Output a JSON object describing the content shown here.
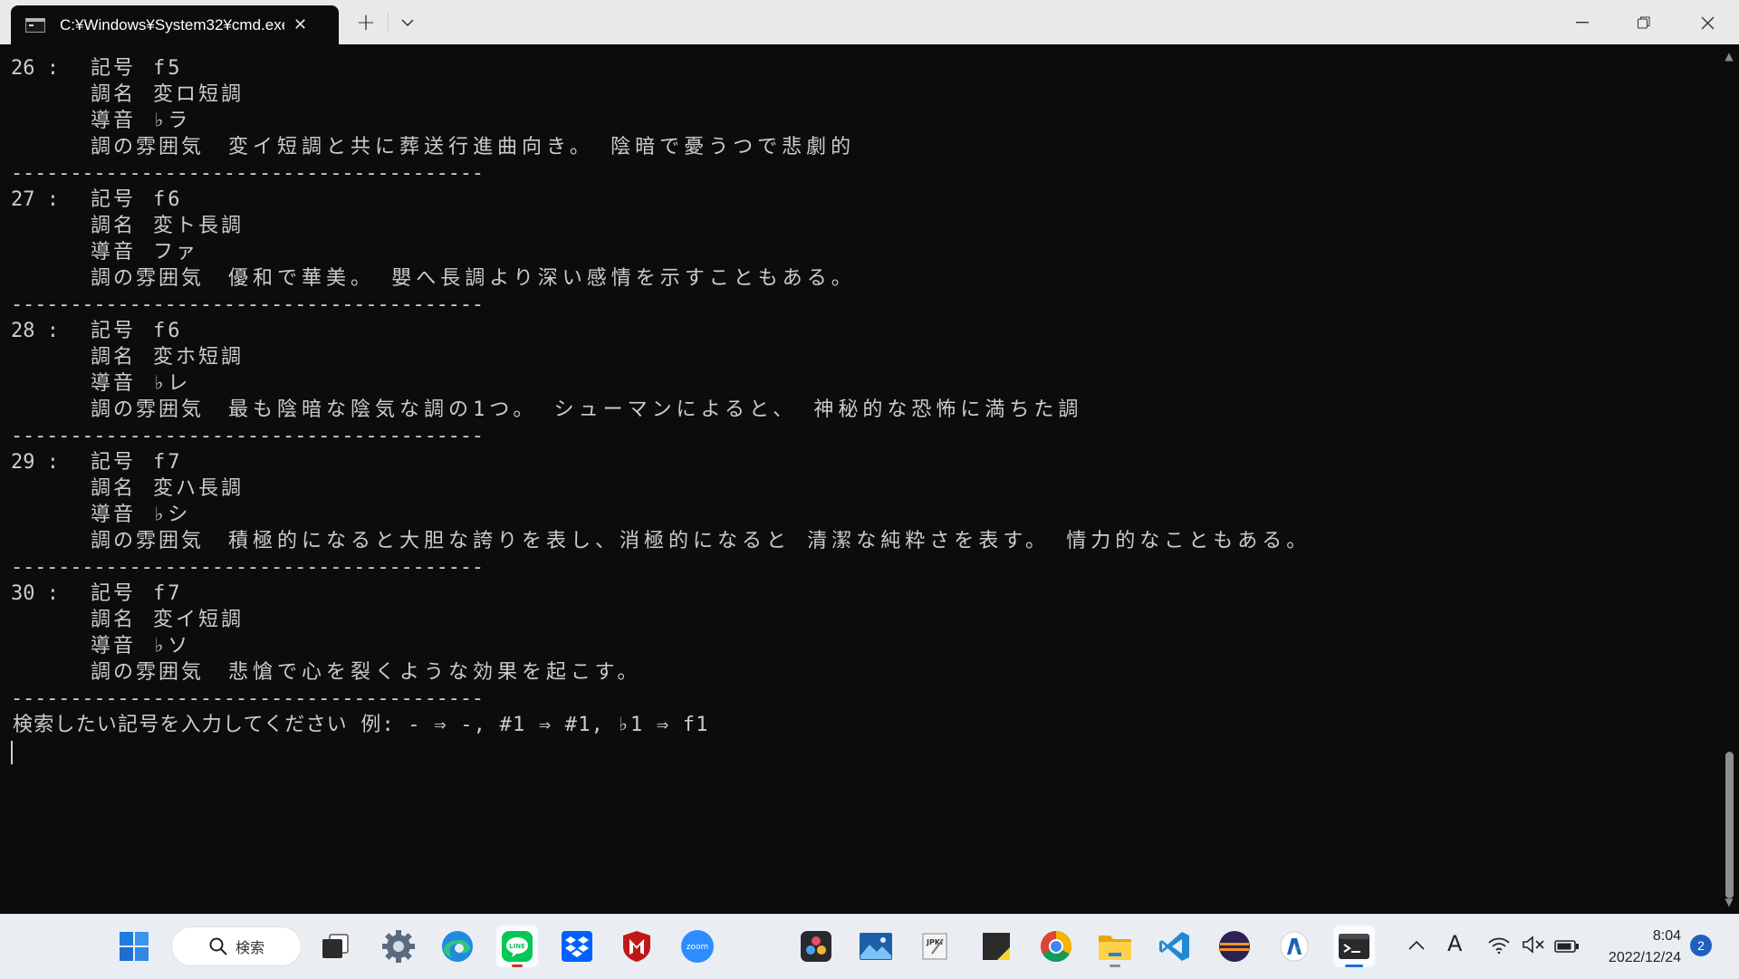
{
  "window": {
    "tab_title": "C:¥Windows¥System32¥cmd.exe",
    "new_tab": "+",
    "dropdown": "⌄",
    "minimize": "─",
    "maximize": "❐",
    "close": "✕"
  },
  "console": {
    "entries": [
      {
        "num": "26 :",
        "symbol_label": "記号",
        "symbol": "f5",
        "key_label": "調名",
        "key": "変ロ短調",
        "leading_label": "導音",
        "leading": "♭ラ",
        "mood_label": "調の雰囲気",
        "mood": "変イ短調と共に葬送行進曲向き。 陰暗で憂うつで悲劇的"
      },
      {
        "num": "27 :",
        "symbol_label": "記号",
        "symbol": "f6",
        "key_label": "調名",
        "key": "変ト長調",
        "leading_label": "導音",
        "leading": "ファ",
        "mood_label": "調の雰囲気",
        "mood": "優和で華美。 嬰へ長調より深い感情を示すこともある。"
      },
      {
        "num": "28 :",
        "symbol_label": "記号",
        "symbol": "f6",
        "key_label": "調名",
        "key": "変ホ短調",
        "leading_label": "導音",
        "leading": "♭レ",
        "mood_label": "調の雰囲気",
        "mood": "最も陰暗な陰気な調の1つ。 シューマンによると、 神秘的な恐怖に満ちた調"
      },
      {
        "num": "29 :",
        "symbol_label": "記号",
        "symbol": "f7",
        "key_label": "調名",
        "key": "変ハ長調",
        "leading_label": "導音",
        "leading": "♭シ",
        "mood_label": "調の雰囲気",
        "mood": "積極的になると大胆な誇りを表し、消極的になると 清潔な純粋さを表す。 情力的なこともある。"
      },
      {
        "num": "30 :",
        "symbol_label": "記号",
        "symbol": "f7",
        "key_label": "調名",
        "key": "変イ短調",
        "leading_label": "導音",
        "leading": "♭ソ",
        "mood_label": "調の雰囲気",
        "mood": "悲愴で心を裂くような効果を起こす。"
      }
    ],
    "separator": "----------------------------------------",
    "prompt": "検索したい記号を入力してください 例: - ⇒ -, #1 ⇒ #1, ♭1 ⇒ f1"
  },
  "scrollbar": {
    "up": "▲",
    "down": "▼",
    "position_fraction": 0.85
  },
  "taskbar": {
    "search_label": "検索",
    "apps": [
      "windows-start",
      "search",
      "task-view",
      "settings",
      "edge",
      "line",
      "dropbox",
      "mcafee",
      "zoom",
      "davinci-resolve",
      "photos",
      "jpki",
      "sticky-notes",
      "chrome",
      "file-explorer",
      "vscode",
      "eclipse",
      "word-app",
      "terminal"
    ],
    "zoom_text": "zoom",
    "jpki_text": "JPKI",
    "tray": {
      "chevron": "^",
      "ime": "A",
      "wifi": "wifi-icon",
      "volume": "speaker-muted-icon",
      "battery": "battery-icon"
    },
    "time": "8:04",
    "date": "2022/12/24",
    "notifications": "2"
  }
}
